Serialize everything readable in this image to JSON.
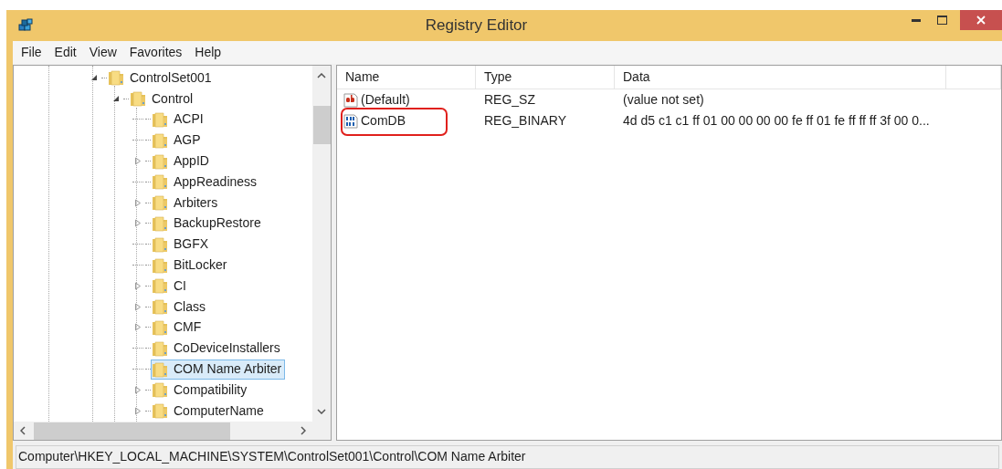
{
  "window": {
    "title": "Registry Editor"
  },
  "menu": [
    {
      "label": "File"
    },
    {
      "label": "Edit"
    },
    {
      "label": "View"
    },
    {
      "label": "Favorites"
    },
    {
      "label": "Help"
    }
  ],
  "tree": [
    {
      "label": "ControlSet001",
      "kind": "expanded",
      "selected": false,
      "children": [
        {
          "label": "Control",
          "kind": "expanded",
          "selected": false,
          "children": [
            {
              "label": "ACPI",
              "kind": "leaf",
              "selected": false
            },
            {
              "label": "AGP",
              "kind": "leaf",
              "selected": false
            },
            {
              "label": "AppID",
              "kind": "collapsed",
              "selected": false
            },
            {
              "label": "AppReadiness",
              "kind": "leaf",
              "selected": false
            },
            {
              "label": "Arbiters",
              "kind": "collapsed",
              "selected": false
            },
            {
              "label": "BackupRestore",
              "kind": "collapsed",
              "selected": false
            },
            {
              "label": "BGFX",
              "kind": "leaf",
              "selected": false
            },
            {
              "label": "BitLocker",
              "kind": "leaf",
              "selected": false
            },
            {
              "label": "CI",
              "kind": "collapsed",
              "selected": false
            },
            {
              "label": "Class",
              "kind": "collapsed",
              "selected": false
            },
            {
              "label": "CMF",
              "kind": "collapsed",
              "selected": false
            },
            {
              "label": "CoDeviceInstallers",
              "kind": "leaf",
              "selected": false
            },
            {
              "label": "COM Name Arbiter",
              "kind": "leaf",
              "selected": true
            },
            {
              "label": "Compatibility",
              "kind": "collapsed",
              "selected": false
            },
            {
              "label": "ComputerName",
              "kind": "collapsed",
              "selected": false
            }
          ]
        }
      ]
    }
  ],
  "values": {
    "columns": [
      "Name",
      "Type",
      "Data"
    ],
    "rows": [
      {
        "kind": "string",
        "name": "(Default)",
        "type": "REG_SZ",
        "data": "(value not set)",
        "highlighted": false
      },
      {
        "kind": "binary",
        "name": "ComDB",
        "type": "REG_BINARY",
        "data": "4d d5 c1 c1 ff 01 00 00 00 00 fe ff 01 fe ff ff ff 3f 00 0...",
        "highlighted": true
      }
    ]
  },
  "status_bar": "Computer\\HKEY_LOCAL_MACHINE\\SYSTEM\\ControlSet001\\Control\\COM Name Arbiter"
}
